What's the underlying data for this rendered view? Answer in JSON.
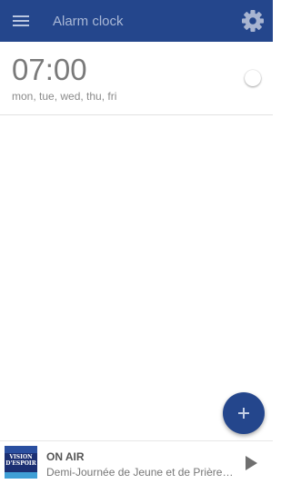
{
  "app_bar": {
    "title": "Alarm clock",
    "menu_icon": "hamburger-menu-icon",
    "settings_icon": "gear-icon",
    "background_color": "#24468c"
  },
  "alarms": [
    {
      "time": "07:00",
      "days": "mon, tue, wed, thu, fri",
      "enabled": false
    }
  ],
  "fab": {
    "icon": "plus-icon",
    "color": "#24468c"
  },
  "player": {
    "status": "ON AIR",
    "program": "Demi-Journée de Jeune et de Prière ...",
    "logo": "station-logo",
    "logo_text": "VISION D'ESPOIR",
    "play_icon": "play-icon"
  }
}
